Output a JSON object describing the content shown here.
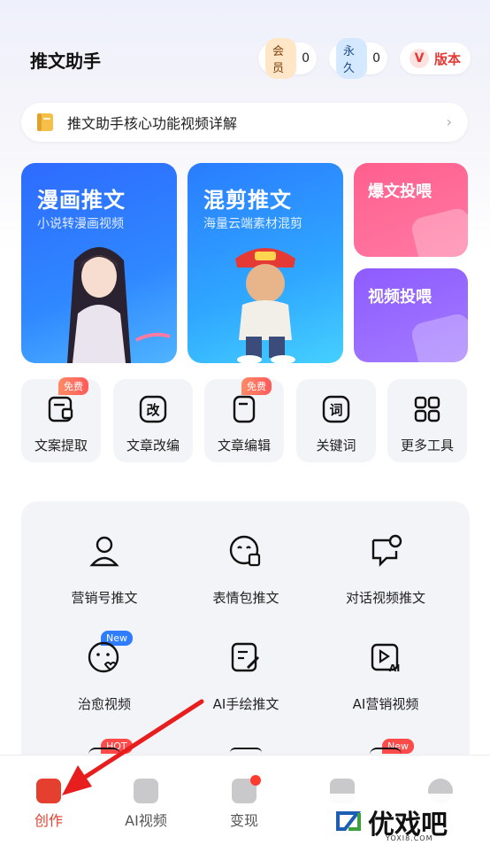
{
  "header": {
    "title": "推文助手",
    "member_label": "会员",
    "member_count": "0",
    "forever_label": "永久",
    "forever_count": "0",
    "version_badge": "V",
    "version_label": "版本"
  },
  "banner": {
    "text": "推文助手核心功能视频详解"
  },
  "feature_cards": {
    "manhua": {
      "title": "漫画推文",
      "subtitle": "小说转漫画视频"
    },
    "hunjian": {
      "title": "混剪推文",
      "subtitle": "海量云端素材混剪"
    },
    "baowen": {
      "title": "爆文投喂"
    },
    "shipin": {
      "title": "视频投喂"
    }
  },
  "tools": [
    {
      "label": "文案提取",
      "badge": "免费",
      "icon": "doc-extract-icon"
    },
    {
      "label": "文章改编",
      "icon": "rewrite-icon"
    },
    {
      "label": "文章编辑",
      "badge": "免费",
      "icon": "doc-edit-icon"
    },
    {
      "label": "关键词",
      "icon": "keyword-icon"
    },
    {
      "label": "更多工具",
      "icon": "grid-icon"
    }
  ],
  "grid": [
    {
      "label": "营销号推文",
      "icon": "person-icon"
    },
    {
      "label": "表情包推文",
      "icon": "emoji-icon"
    },
    {
      "label": "对话视频推文",
      "icon": "chat-icon"
    },
    {
      "label": "治愈视频",
      "badge": "New",
      "icon": "heart-face-icon"
    },
    {
      "label": "AI手绘推文",
      "icon": "draw-icon"
    },
    {
      "label": "AI营销视频",
      "icon": "ai-video-icon"
    }
  ],
  "badges": {
    "hot": "HOT",
    "new": "New"
  },
  "tabbar": [
    {
      "label": "创作",
      "active": true
    },
    {
      "label": "AI视频"
    },
    {
      "label": "变现"
    },
    {
      "label": ""
    },
    {
      "label": ""
    }
  ],
  "watermark": {
    "text": "优戏吧",
    "sub": "YOXI8.COM"
  },
  "colors": {
    "accent": "#e5402f",
    "blue": "#2f7dff",
    "pink": "#ff5f8d",
    "purple": "#8e5bff"
  }
}
